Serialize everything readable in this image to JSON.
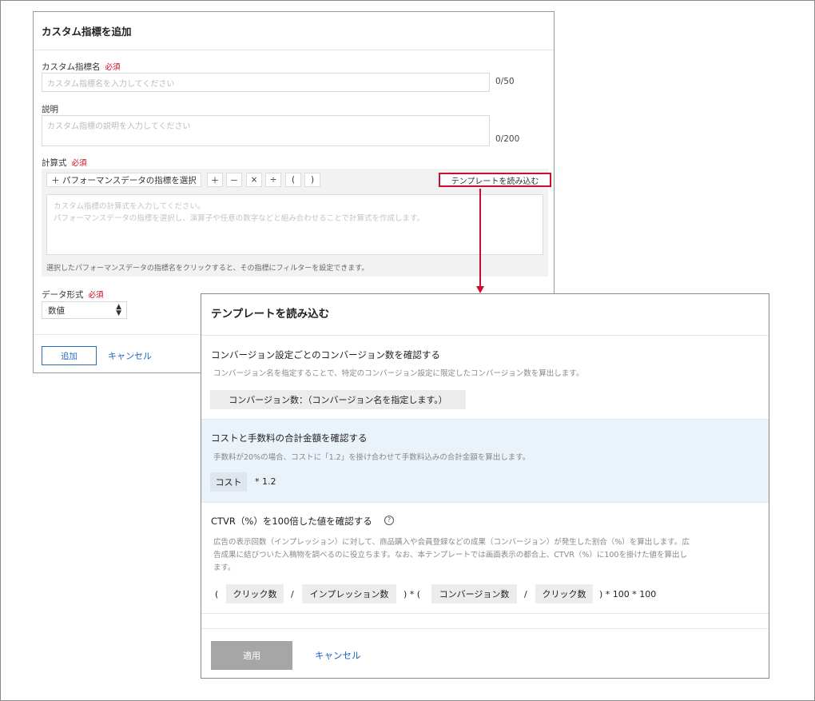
{
  "custom_metric_dialog": {
    "title": "カスタム指標を追加",
    "name_label": "カスタム指標名",
    "required": "必須",
    "name_placeholder": "カスタム指標名を入力してください",
    "name_counter": "0/50",
    "description_label": "説明",
    "description_placeholder": "カスタム指標の説明を入力してください",
    "description_counter": "0/200",
    "formula_label": "計算式",
    "select_metric_button": "＋ パフォーマンスデータの指標を選択",
    "operators": [
      "＋",
      "－",
      "×",
      "÷",
      "(",
      ")"
    ],
    "load_template_button": "テンプレートを読み込む",
    "formula_placeholder_line1": "カスタム指標の計算式を入力してください。",
    "formula_placeholder_line2": "パフォーマンスデータの指標を選択し、演算子や任意の数字などと組み合わせることで計算式を作成します。",
    "formula_hint": "選択したパフォーマンスデータの指標名をクリックすると、その指標にフィルターを設定できます。",
    "data_format_label": "データ形式",
    "data_format_value": "数値",
    "add_button": "追加",
    "cancel_link": "キャンセル"
  },
  "template_dialog": {
    "title": "テンプレートを読み込む",
    "templates": [
      {
        "title": "コンバージョン設定ごとのコンバージョン数を確認する",
        "description": "コンバージョン名を指定することで、特定のコンバージョン設定に限定したコンバージョン数を算出します。",
        "formula_chip": "コンバージョン数：（コンバージョン名を指定します。）"
      },
      {
        "title": "コストと手数料の合計金額を確認する",
        "description": "手数料が20%の場合、コストに「1.2」を掛け合わせて手数料込みの合計金額を算出します。",
        "formula_chip": "コスト",
        "formula_rest": "* 1.2"
      },
      {
        "title": "CTVR（%）を100倍した値を確認する",
        "description_lines": [
          "広告の表示回数（インプレッション）に対して、商品購入や会員登録などの成果（コンバージョン）が発生した割合（%）を算出します。広",
          "告成果に結びついた入稿物を調べるのに役立ちます。なお、本テンプレートでは画面表示の都合上、CTVR（%）に100を掛けた値を算出し",
          "ます。"
        ],
        "formula": {
          "open1": "(",
          "chip1": "クリック数",
          "slash1": "/",
          "chip2": "インプレッション数",
          "mid": ") * (",
          "chip3": "コンバージョン数",
          "slash2": "/",
          "chip4": "クリック数",
          "tail": ") * 100 * 100"
        }
      }
    ],
    "apply_button": "適用",
    "cancel_link": "キャンセル"
  }
}
